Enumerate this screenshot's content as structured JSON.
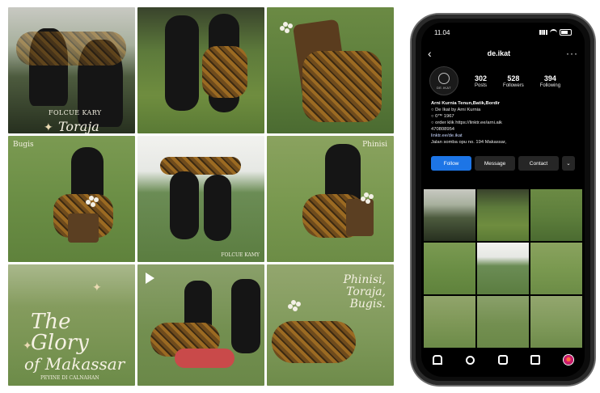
{
  "collage": {
    "tile1": {
      "small": "FOLCUE KARY",
      "big": "Toraja"
    },
    "tile4": {
      "label": "Bugis"
    },
    "tile5": {
      "small": "FOLCUE KAMY"
    },
    "tile6": {
      "label": "Phinisi"
    },
    "tile7": {
      "line1": "The Glory",
      "line2": "of Makassar",
      "small": "PEYINE DI CALNAHAN"
    },
    "tile9": {
      "lines": [
        "Phinisi,",
        "Toraja,",
        "Bugis."
      ]
    }
  },
  "phone": {
    "status": {
      "time": "11.04"
    },
    "header": {
      "username": "de.ikat",
      "back_icon": "chevron-left-icon",
      "more_icon": "more-icon"
    },
    "avatar": {
      "text": "DE.IKAT"
    },
    "stats": [
      {
        "num": "302",
        "label": "Posts"
      },
      {
        "num": "528",
        "label": "Followers"
      },
      {
        "num": "394",
        "label": "Following"
      }
    ],
    "bio": [
      "Arni Kurnia Tenun,Batik,Bordir",
      "○ De Ikat by Arni Kurnia",
      "○ 0™ 1967",
      "○ order klik https://linktr.ee/arni.aik",
      "470808954",
      "linktr.ee/de.ikat",
      "Jalan somba opu no. 194 Makassar,"
    ],
    "buttons": {
      "follow": "Follow",
      "message": "Message",
      "contact": "Contact",
      "more": "⌄"
    }
  },
  "icons": {
    "play": "play-icon",
    "home": "home-icon",
    "search": "search-icon",
    "reels": "reels-icon",
    "shop": "shop-icon",
    "profile": "profile-avatar-icon"
  }
}
